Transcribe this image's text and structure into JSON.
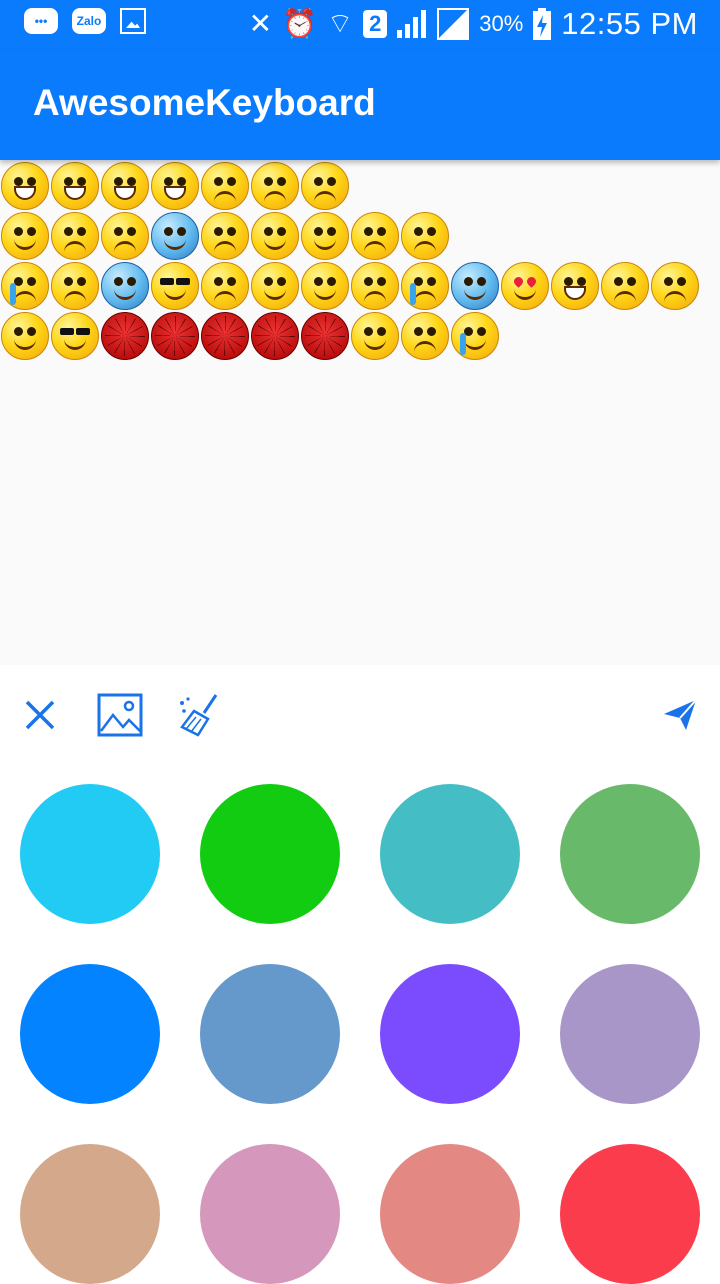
{
  "status_bar": {
    "zalo_label": "Zalo",
    "sim_number": "2",
    "battery_percent": "30%",
    "time": "12:55 PM",
    "icons": [
      "chat-bubble-icon",
      "zalo-icon",
      "gallery-icon",
      "vibrate-off-icon",
      "alarm-icon",
      "wifi-icon",
      "sim-2-icon",
      "signal-icon",
      "signal-empty-icon",
      "battery-charging-icon"
    ]
  },
  "app_bar": {
    "title": "AwesomeKeyboard"
  },
  "content": {
    "emoji_rows": [
      [
        "grin",
        "grin",
        "grin",
        "grin",
        "brick",
        "brick",
        "brick"
      ],
      [
        "sweat",
        "angry",
        "angry",
        "cold",
        "frown",
        "drool",
        "drool",
        "frown",
        "frown"
      ],
      [
        "cry",
        "angry",
        "cold",
        "cool",
        "frown",
        "sleepy",
        "drool",
        "sad",
        "cry",
        "cold",
        "love",
        "grin",
        "frown",
        "bleed"
      ],
      [
        "smirk",
        "cool",
        "spider",
        "spider",
        "spider",
        "spider",
        "spider",
        "kiss",
        "dizzy",
        "tear"
      ]
    ]
  },
  "toolbar": {
    "close_icon": "close-icon",
    "image_icon": "image-icon",
    "clear_icon": "broom-icon",
    "send_icon": "send-icon",
    "accent_color": "#1a73e8"
  },
  "palette": {
    "colors": [
      "#21cbf3",
      "#12cc12",
      "#44bec4",
      "#68b96a",
      "#0383ff",
      "#6599cb",
      "#7b4cfe",
      "#a896c9",
      "#d4a98b",
      "#d597bb",
      "#e48884",
      "#fb3c4d"
    ]
  },
  "theme": {
    "primary": "#0a7bfc",
    "content_bg": "#fafafa"
  }
}
